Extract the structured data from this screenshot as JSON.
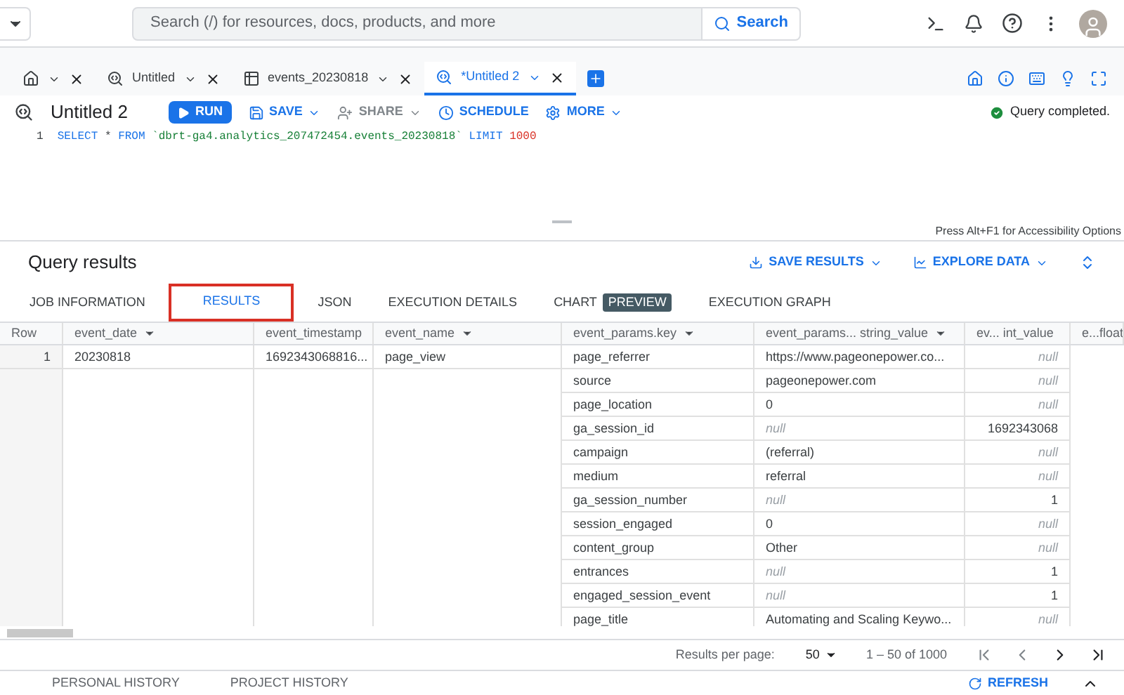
{
  "header": {
    "search": {
      "placeholder": "Search (/) for resources, docs, products, and more",
      "button": "Search"
    }
  },
  "editor_tabs": [
    {
      "kind": "home",
      "selected": false
    },
    {
      "kind": "query",
      "label": "Untitled",
      "selected": false
    },
    {
      "kind": "table",
      "label": "events_20230818",
      "selected": false
    },
    {
      "kind": "query",
      "label": "*Untitled 2",
      "selected": true
    }
  ],
  "toolbar": {
    "title": "Untitled 2",
    "run": "RUN",
    "save": "SAVE",
    "share": "SHARE",
    "schedule": "SCHEDULE",
    "more": "MORE",
    "status": "Query completed."
  },
  "editor": {
    "line_number": "1",
    "tokens": [
      {
        "kind": "keyword",
        "text": "SELECT"
      },
      {
        "kind": "plain",
        "text": "*"
      },
      {
        "kind": "keyword",
        "text": "FROM"
      },
      {
        "kind": "string",
        "text": "`dbrt-ga4.analytics_207472454.events_20230818`"
      },
      {
        "kind": "keyword",
        "text": "LIMIT"
      },
      {
        "kind": "number",
        "text": "1000"
      }
    ],
    "hint": "Press Alt+F1 for Accessibility Options"
  },
  "results": {
    "title": "Query results",
    "save_results": "SAVE RESULTS",
    "explore_data": "EXPLORE DATA",
    "tabs": [
      {
        "label": "JOB INFORMATION",
        "selected": false
      },
      {
        "label": "RESULTS",
        "selected": true
      },
      {
        "label": "JSON",
        "selected": false
      },
      {
        "label": "EXECUTION DETAILS",
        "selected": false
      },
      {
        "label": "CHART",
        "badge": "PREVIEW",
        "selected": false
      },
      {
        "label": "EXECUTION GRAPH",
        "selected": false
      }
    ]
  },
  "table": {
    "columns": [
      "Row",
      "event_date",
      "event_timestamp",
      "event_name",
      "event_params.key",
      "event_params... string_value",
      "ev... int_value",
      "e...float"
    ],
    "rows": [
      {
        "row": "1",
        "event_date": "20230818",
        "event_timestamp": "1692343068816...",
        "event_name": "page_view",
        "params": [
          {
            "key": "page_referrer",
            "string_value": {
              "text": "https://www.pageonepower.co...",
              "null": false
            },
            "int_value": {
              "text": "null",
              "null": true
            }
          },
          {
            "key": "source",
            "string_value": {
              "text": "pageonepower.com",
              "null": false
            },
            "int_value": {
              "text": "null",
              "null": true
            }
          },
          {
            "key": "page_location",
            "string_value": {
              "text": "0",
              "null": false
            },
            "int_value": {
              "text": "null",
              "null": true
            }
          },
          {
            "key": "ga_session_id",
            "string_value": {
              "text": "null",
              "null": true
            },
            "int_value": {
              "text": "1692343068",
              "null": false
            }
          },
          {
            "key": "campaign",
            "string_value": {
              "text": "(referral)",
              "null": false
            },
            "int_value": {
              "text": "null",
              "null": true
            }
          },
          {
            "key": "medium",
            "string_value": {
              "text": "referral",
              "null": false
            },
            "int_value": {
              "text": "null",
              "null": true
            }
          },
          {
            "key": "ga_session_number",
            "string_value": {
              "text": "null",
              "null": true
            },
            "int_value": {
              "text": "1",
              "null": false
            }
          },
          {
            "key": "session_engaged",
            "string_value": {
              "text": "0",
              "null": false
            },
            "int_value": {
              "text": "null",
              "null": true
            }
          },
          {
            "key": "content_group",
            "string_value": {
              "text": "Other",
              "null": false
            },
            "int_value": {
              "text": "null",
              "null": true
            }
          },
          {
            "key": "entrances",
            "string_value": {
              "text": "null",
              "null": true
            },
            "int_value": {
              "text": "1",
              "null": false
            }
          },
          {
            "key": "engaged_session_event",
            "string_value": {
              "text": "null",
              "null": true
            },
            "int_value": {
              "text": "1",
              "null": false
            }
          },
          {
            "key": "page_title",
            "string_value": {
              "text": "Automating and Scaling Keywo...",
              "null": false
            },
            "int_value": {
              "text": "null",
              "null": true
            }
          }
        ]
      }
    ]
  },
  "pagination": {
    "label": "Results per page:",
    "per_page": "50",
    "range": "1 – 50 of 1000"
  },
  "bottom": {
    "tabs": [
      "PERSONAL HISTORY",
      "PROJECT HISTORY"
    ],
    "refresh": "REFRESH"
  }
}
